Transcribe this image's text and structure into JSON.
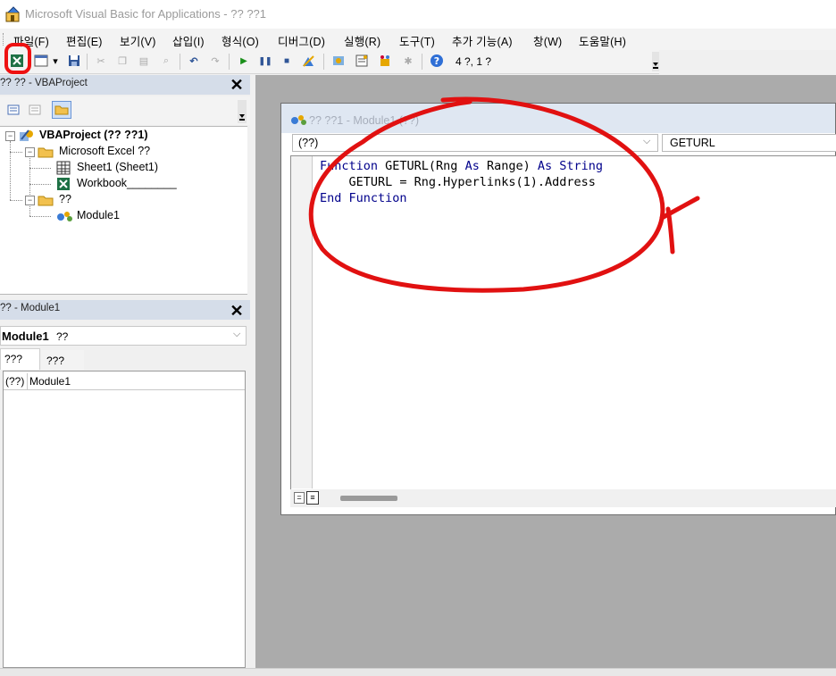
{
  "window": {
    "title": "Microsoft Visual Basic for Applications - ?? ??1"
  },
  "menu": [
    {
      "label": "파일(F)"
    },
    {
      "label": "편집(E)"
    },
    {
      "label": "보기(V)"
    },
    {
      "label": "삽입(I)"
    },
    {
      "label": "형식(O)"
    },
    {
      "label": "디버그(D)"
    },
    {
      "label": "실행(R)"
    },
    {
      "label": "도구(T)"
    },
    {
      "label": "추가 기능(A)"
    },
    {
      "label": "창(W)"
    },
    {
      "label": "도움말(H)"
    }
  ],
  "toolbar": {
    "position_text": "4 ?, 1 ?"
  },
  "project_pane": {
    "title": "?? ?? - VBAProject",
    "tree": {
      "root": "VBAProject (?? ??1)",
      "excel_folder": "Microsoft Excel ??",
      "sheet1": "Sheet1 (Sheet1)",
      "workbook": "Workbook________",
      "modules_folder": "??",
      "module1": "Module1"
    }
  },
  "properties_pane": {
    "title": "?? - Module1",
    "combo_object": "Module1",
    "combo_type": "??",
    "tab_alpha": "???",
    "tab_category": "???",
    "row_label": "(??)",
    "row_value": "Module1"
  },
  "code_window": {
    "title": "?? ??1 - Module1 (??)",
    "object_combo": "(??)",
    "procedure_combo": "GETURL",
    "lines": [
      {
        "keyword": "Function",
        "rest": " GETURL(Rng ",
        "kw2": "As",
        "mid": " Range) ",
        "kw3": "As",
        "mid2": " ",
        "kw4": "String"
      },
      {
        "text": "    GETURL = Rng.Hyperlinks(1).Address"
      },
      {
        "keyword": "End Function"
      }
    ]
  },
  "colors": {
    "annotation": "#e11111",
    "keyword": "#00008b",
    "pane_header": "#d5dde9"
  }
}
